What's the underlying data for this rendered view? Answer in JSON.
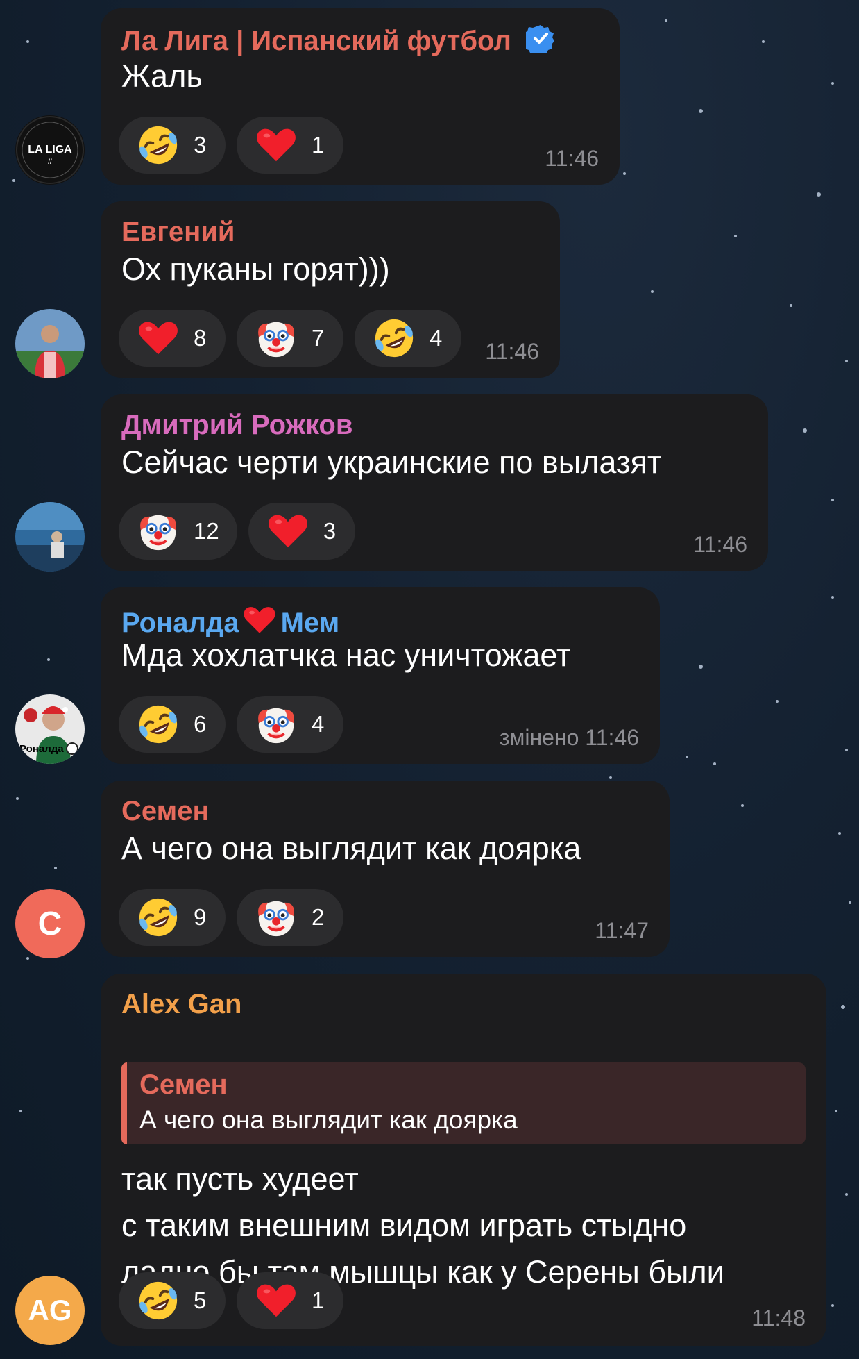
{
  "messages": [
    {
      "name": "Ла Лига | Испанский футбол",
      "name_color": "#e56a5c",
      "verified": true,
      "avatar": {
        "type": "logo",
        "text": "LA LIGA",
        "bg": "#111111"
      },
      "text": "Жаль",
      "time": "11:46",
      "reactions": [
        {
          "icon": "rofl-emoji-icon",
          "count": "3"
        },
        {
          "icon": "heart-emoji-icon",
          "count": "1"
        }
      ]
    },
    {
      "name": "Евгений",
      "name_color": "#e56a5c",
      "avatar": {
        "type": "photo",
        "bg": "#3f6e9a"
      },
      "text": "Ох пуканы горят)))",
      "time": "11:46",
      "reactions": [
        {
          "icon": "heart-emoji-icon",
          "count": "8"
        },
        {
          "icon": "clown-emoji-icon",
          "count": "7"
        },
        {
          "icon": "rofl-emoji-icon",
          "count": "4"
        }
      ]
    },
    {
      "name": "Дмитрий Рожков",
      "name_color": "#d86bbd",
      "avatar": {
        "type": "photo",
        "bg": "#2f5f8a"
      },
      "text": "Сейчас черти украинские по вылазят",
      "time": "11:46",
      "reactions": [
        {
          "icon": "clown-emoji-icon",
          "count": "12"
        },
        {
          "icon": "heart-emoji-icon",
          "count": "3"
        }
      ]
    },
    {
      "name_part1": "Роналда",
      "name_part2": "Мем",
      "name_color": "#5aa8f0",
      "avatar": {
        "type": "photo",
        "bg": "#e8e8e8",
        "caption": "Роналда"
      },
      "text": "Мда хохлатчка нас уничтожает",
      "time": "змінено 11:46",
      "reactions": [
        {
          "icon": "rofl-emoji-icon",
          "count": "6"
        },
        {
          "icon": "clown-emoji-icon",
          "count": "4"
        }
      ]
    },
    {
      "name": "Семен",
      "name_color": "#e56a5c",
      "avatar": {
        "type": "initials",
        "text": "С",
        "bg": "#f06a5a"
      },
      "text": "А чего она выглядит как доярка",
      "time": "11:47",
      "reactions": [
        {
          "icon": "rofl-emoji-icon",
          "count": "9"
        },
        {
          "icon": "clown-emoji-icon",
          "count": "2"
        }
      ]
    },
    {
      "name": "Alex Gan",
      "name_color": "#f2a04a",
      "avatar": {
        "type": "initials",
        "text": "AG",
        "bg": "#f4a94a"
      },
      "reply": {
        "name": "Семен",
        "text": "А чего она выглядит как доярка"
      },
      "lines": [
        "так пусть худеет",
        "с таким внешним видом играть стыдно",
        "ладно бы там мышцы как у Серены были"
      ],
      "time": "11:48",
      "reactions": [
        {
          "icon": "rofl-emoji-icon",
          "count": "5"
        },
        {
          "icon": "heart-emoji-icon",
          "count": "1"
        }
      ]
    }
  ],
  "colors": {
    "bubble": "#1c1c1e",
    "reaction_bg": "#2c2c2e",
    "time": "#8e8e93",
    "verified": "#3a8ff0"
  }
}
